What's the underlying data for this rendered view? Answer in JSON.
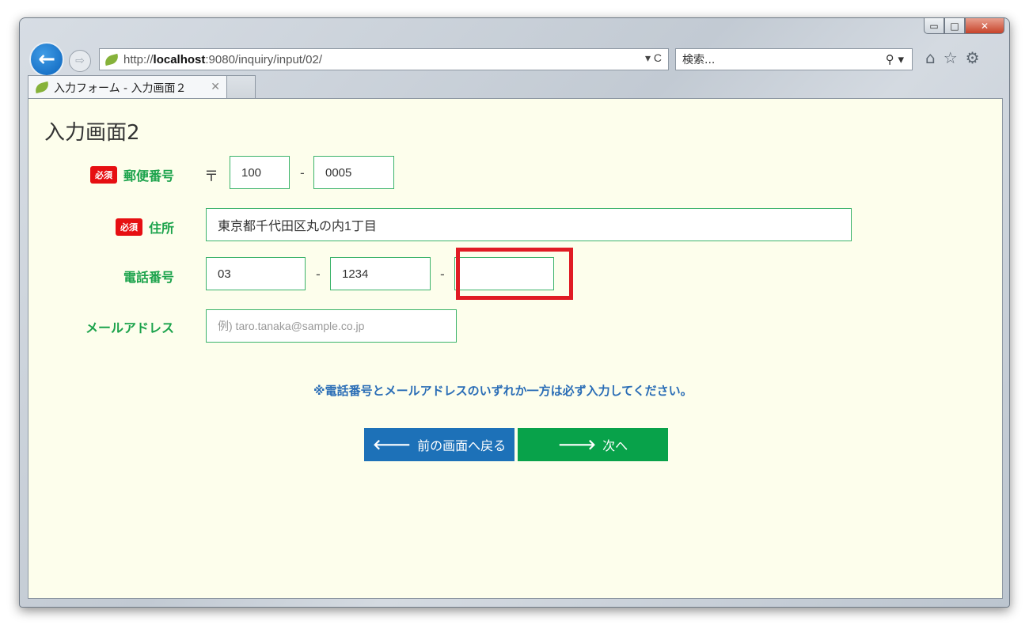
{
  "browser": {
    "url_scheme": "http://",
    "url_host": "localhost",
    "url_rest": ":9080/inquiry/input/02/",
    "search_placeholder": "検索...",
    "tab_title": "入力フォーム - 入力画面２",
    "caption": {
      "minimize": "▭",
      "maximize": "□",
      "close": "✕"
    }
  },
  "page": {
    "title": "入力画面2",
    "required_badge": "必須",
    "postal": {
      "label": "郵便番号",
      "mark": "〒",
      "part1": "100",
      "part2": "0005",
      "separator": "-"
    },
    "address": {
      "label": "住所",
      "value": "東京都千代田区丸の内1丁目"
    },
    "phone": {
      "label": "電話番号",
      "part1": "03",
      "part2": "1234",
      "part3": "",
      "separator": "-"
    },
    "email": {
      "label": "メールアドレス",
      "placeholder": "例) taro.tanaka@sample.co.jp"
    },
    "note": "※電話番号とメールアドレスのいずれか一方は必ず入力してください。",
    "buttons": {
      "back": "前の画面へ戻る",
      "next": "次へ"
    }
  },
  "colors": {
    "label_green": "#1ca34c",
    "required_red": "#e60f12",
    "note_blue": "#2a6db6",
    "back_blue": "#1d71b8",
    "next_green": "#08a24a",
    "highlight_red": "#e01b24",
    "page_bg": "#fdfeec"
  }
}
